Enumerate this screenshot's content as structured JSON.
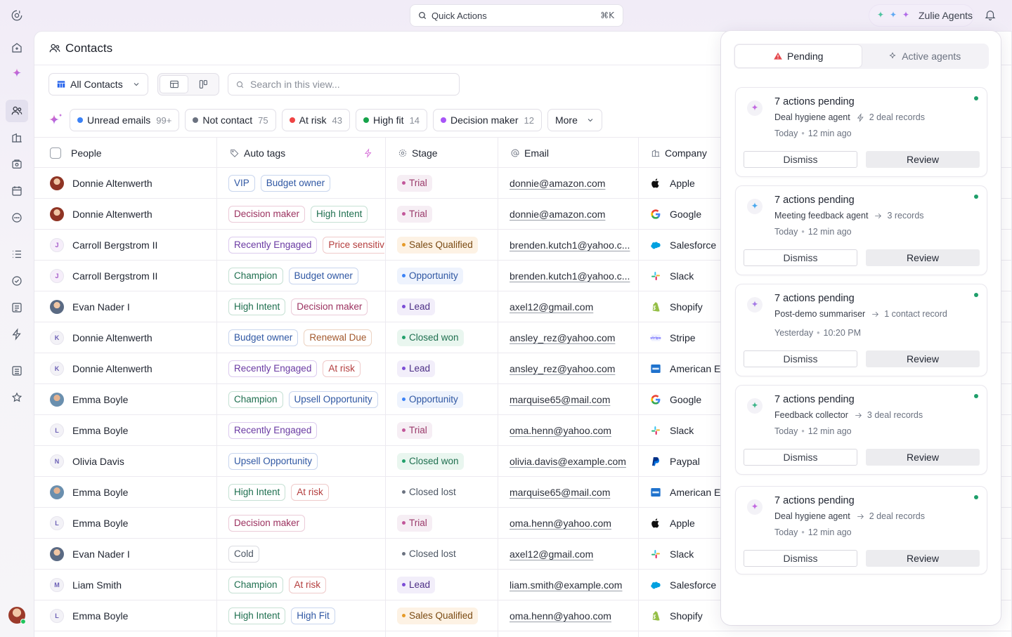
{
  "topbar": {
    "quick_actions_label": "Quick Actions",
    "quick_actions_shortcut": "⌘K",
    "agents_label": "Zulie Agents"
  },
  "rail": {
    "icons": [
      "logo-icon",
      "home-icon",
      "ai-sparkle-icon",
      "contacts-icon",
      "companies-icon",
      "deals-icon",
      "calendar-icon",
      "chat-icon",
      "list-icon",
      "tasks-icon",
      "notes-icon",
      "automations-icon",
      "reports-icon",
      "favorites-icon"
    ]
  },
  "page": {
    "title": "Contacts",
    "view_label": "All Contacts",
    "search_placeholder": "Search in this view...",
    "filters": [
      {
        "label": "Unread emails",
        "count": "99+",
        "color": "#3b82f6"
      },
      {
        "label": "Not contact",
        "count": "75",
        "color": "#6b7280"
      },
      {
        "label": "At risk",
        "count": "43",
        "color": "#ef4444"
      },
      {
        "label": "High fit",
        "count": "14",
        "color": "#16a34a"
      },
      {
        "label": "Decision maker",
        "count": "12",
        "color": "#a855f7"
      }
    ],
    "more_label": "More"
  },
  "table": {
    "columns": {
      "people": "People",
      "auto_tags": "Auto tags",
      "stage": "Stage",
      "email": "Email",
      "company": "Company"
    },
    "rows": [
      {
        "name": "Donnie Altenwerth",
        "avatar": "photo",
        "tags": [
          {
            "t": "VIP",
            "c": "t-blue"
          },
          {
            "t": "Budget owner",
            "c": "t-blue"
          }
        ],
        "stage": "Trial",
        "sc": "st-trial",
        "email": "donnie@amazon.com",
        "company": "Apple",
        "logo": "apple"
      },
      {
        "name": "Donnie Altenwerth",
        "avatar": "photo",
        "tags": [
          {
            "t": "Decision maker",
            "c": "t-rose"
          },
          {
            "t": "High Intent",
            "c": "t-green"
          }
        ],
        "stage": "Trial",
        "sc": "st-trial",
        "email": "donnie@amazon.com",
        "company": "Google",
        "logo": "google"
      },
      {
        "name": "Carroll Bergstrom II",
        "avatar": "J",
        "tags": [
          {
            "t": "Recently Engaged",
            "c": "t-purple"
          },
          {
            "t": "Price sensitive",
            "c": "t-red"
          }
        ],
        "stage": "Sales Qualified",
        "sc": "st-sq",
        "email": "brenden.kutch1@yahoo.c...",
        "company": "Salesforce",
        "logo": "salesforce"
      },
      {
        "name": "Carroll Bergstrom II",
        "avatar": "J",
        "tags": [
          {
            "t": "Champion",
            "c": "t-green"
          },
          {
            "t": "Budget owner",
            "c": "t-blue"
          }
        ],
        "stage": "Opportunity",
        "sc": "st-opp",
        "email": "brenden.kutch1@yahoo.c...",
        "company": "Slack",
        "logo": "slack"
      },
      {
        "name": "Evan Nader I",
        "avatar": "photo2",
        "tags": [
          {
            "t": "High Intent",
            "c": "t-green"
          },
          {
            "t": "Decision maker",
            "c": "t-rose"
          }
        ],
        "stage": "Lead",
        "sc": "st-lead",
        "email": "axel12@gmail.com",
        "company": "Shopify",
        "logo": "shopify"
      },
      {
        "name": "Donnie Altenwerth",
        "avatar": "K",
        "tags": [
          {
            "t": "Budget owner",
            "c": "t-blue"
          },
          {
            "t": "Renewal Due",
            "c": "t-orange"
          }
        ],
        "stage": "Closed won",
        "sc": "st-won",
        "email": "ansley_rez@yahoo.com",
        "company": "Stripe",
        "logo": "stripe"
      },
      {
        "name": "Donnie Altenwerth",
        "avatar": "K",
        "tags": [
          {
            "t": "Recently Engaged",
            "c": "t-purple"
          },
          {
            "t": "At risk",
            "c": "t-red"
          }
        ],
        "stage": "Lead",
        "sc": "st-lead",
        "email": "ansley_rez@yahoo.com",
        "company": "American Express",
        "logo": "amex"
      },
      {
        "name": "Emma Boyle",
        "avatar": "photo3",
        "tags": [
          {
            "t": "Champion",
            "c": "t-green"
          },
          {
            "t": "Upsell Opportunity",
            "c": "t-blue"
          }
        ],
        "stage": "Opportunity",
        "sc": "st-opp",
        "email": "marquise65@mail.com",
        "company": "Google",
        "logo": "google"
      },
      {
        "name": "Emma Boyle",
        "avatar": "L",
        "tags": [
          {
            "t": "Recently Engaged",
            "c": "t-purple"
          }
        ],
        "stage": "Trial",
        "sc": "st-trial",
        "email": "oma.henn@yahoo.com",
        "company": "Slack",
        "logo": "slack"
      },
      {
        "name": "Olivia Davis",
        "avatar": "N",
        "tags": [
          {
            "t": "Upsell Opportunity",
            "c": "t-blue"
          }
        ],
        "stage": "Closed won",
        "sc": "st-won",
        "email": "olivia.davis@example.com",
        "company": "Paypal",
        "logo": "paypal"
      },
      {
        "name": "Emma Boyle",
        "avatar": "photo3",
        "tags": [
          {
            "t": "High Intent",
            "c": "t-green"
          },
          {
            "t": "At risk",
            "c": "t-red"
          }
        ],
        "stage": "Closed lost",
        "sc": "st-lost",
        "email": "marquise65@mail.com",
        "company": "American Express",
        "logo": "amex"
      },
      {
        "name": "Emma Boyle",
        "avatar": "L",
        "tags": [
          {
            "t": "Decision maker",
            "c": "t-rose"
          }
        ],
        "stage": "Trial",
        "sc": "st-trial",
        "email": "oma.henn@yahoo.com",
        "company": "Apple",
        "logo": "apple"
      },
      {
        "name": "Evan Nader I",
        "avatar": "photo2",
        "tags": [
          {
            "t": "Cold",
            "c": "t-gray"
          }
        ],
        "stage": "Closed lost",
        "sc": "st-lost",
        "email": "axel12@gmail.com",
        "company": "Slack",
        "logo": "slack"
      },
      {
        "name": "Liam Smith",
        "avatar": "M",
        "tags": [
          {
            "t": "Champion",
            "c": "t-green"
          },
          {
            "t": "At risk",
            "c": "t-red"
          }
        ],
        "stage": "Lead",
        "sc": "st-lead",
        "email": "liam.smith@example.com",
        "company": "Salesforce",
        "logo": "salesforce"
      },
      {
        "name": "Emma Boyle",
        "avatar": "L",
        "tags": [
          {
            "t": "High Intent",
            "c": "t-green"
          },
          {
            "t": "High Fit",
            "c": "t-blue"
          }
        ],
        "stage": "Sales Qualified",
        "sc": "st-sq",
        "email": "oma.henn@yahoo.com",
        "company": "Shopify",
        "logo": "shopify"
      }
    ]
  },
  "panel": {
    "tab_pending": "Pending",
    "tab_active": "Active agents",
    "dismiss_label": "Dismiss",
    "review_label": "Review",
    "cards": [
      {
        "title": "7 actions pending",
        "agent": "Deal hygiene agent",
        "connector": "bolt",
        "records": "2 deal records",
        "when": "Today",
        "time": "12 min ago",
        "sparkle": "#c26ae0"
      },
      {
        "title": "7 actions pending",
        "agent": "Meeting feedback agent",
        "connector": "arrow",
        "records": "3 records",
        "when": "Today",
        "time": "12 min ago",
        "sparkle": "#4aa8ee"
      },
      {
        "title": "7 actions pending",
        "agent": "Post-demo summariser",
        "connector": "arrow",
        "records": "1 contact record",
        "when": "Yesterday",
        "time": "10:20 PM",
        "sparkle": "#a67be6"
      },
      {
        "title": "7 actions pending",
        "agent": "Feedback collector",
        "connector": "arrow",
        "records": "3 deal records",
        "when": "Today",
        "time": "12 min ago",
        "sparkle": "#3fb58a"
      },
      {
        "title": "7 actions pending",
        "agent": "Deal hygiene agent",
        "connector": "arrow",
        "records": "2 deal records",
        "when": "Today",
        "time": "12 min ago",
        "sparkle": "#c26ae0"
      }
    ]
  }
}
